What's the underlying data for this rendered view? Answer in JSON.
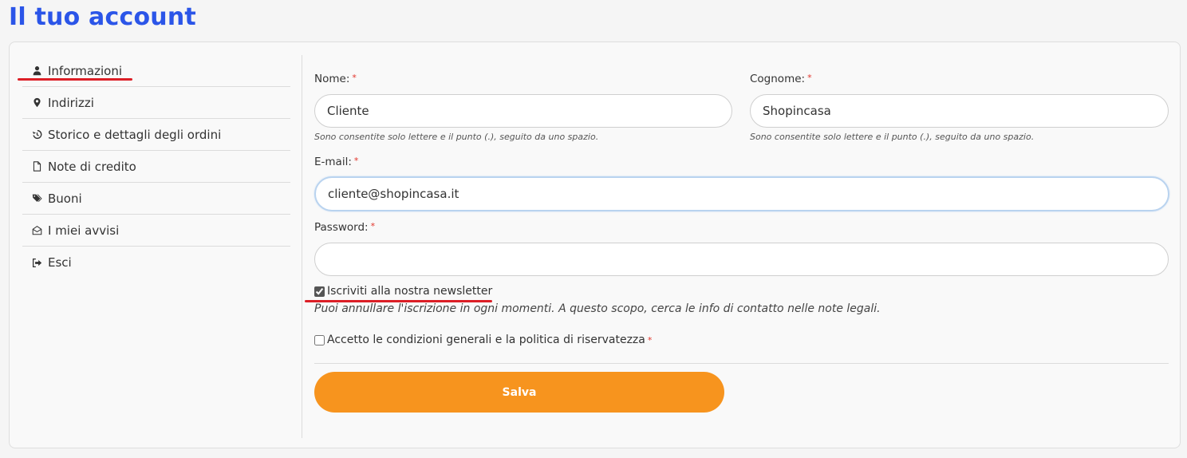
{
  "page": {
    "title": "Il tuo account"
  },
  "sidebar": {
    "items": [
      {
        "label": "Informazioni",
        "icon": "user-icon"
      },
      {
        "label": "Indirizzi",
        "icon": "map-marker-icon"
      },
      {
        "label": "Storico e dettagli degli ordini",
        "icon": "history-icon"
      },
      {
        "label": "Note di credito",
        "icon": "file-icon"
      },
      {
        "label": "Buoni",
        "icon": "tags-icon"
      },
      {
        "label": "I miei avvisi",
        "icon": "envelope-open-icon"
      },
      {
        "label": "Esci",
        "icon": "sign-out-icon"
      }
    ]
  },
  "form": {
    "first_name": {
      "label": "Nome:",
      "required": "*",
      "value": "Cliente",
      "hint": "Sono consentite solo lettere e il punto (.), seguito da uno spazio."
    },
    "last_name": {
      "label": "Cognome:",
      "required": "*",
      "value": "Shopincasa",
      "hint": "Sono consentite solo lettere e il punto (.), seguito da uno spazio."
    },
    "email": {
      "label": "E-mail:",
      "required": "*",
      "value": "cliente@shopincasa.it"
    },
    "password": {
      "label": "Password:",
      "required": "*",
      "value": ""
    },
    "newsletter": {
      "label": "Iscriviti alla nostra newsletter",
      "checked": true,
      "note": "Puoi annullare l'iscrizione in ogni momenti. A questo scopo, cerca le info di contatto nelle note legali."
    },
    "terms": {
      "label": "Accetto le condizioni generali e la politica di riservatezza",
      "required": "*",
      "checked": false
    },
    "save_label": "Salva"
  },
  "colors": {
    "title": "#2b55e8",
    "accent": "#f7941e",
    "underline": "#dc1f26",
    "required": "#e2352b"
  }
}
